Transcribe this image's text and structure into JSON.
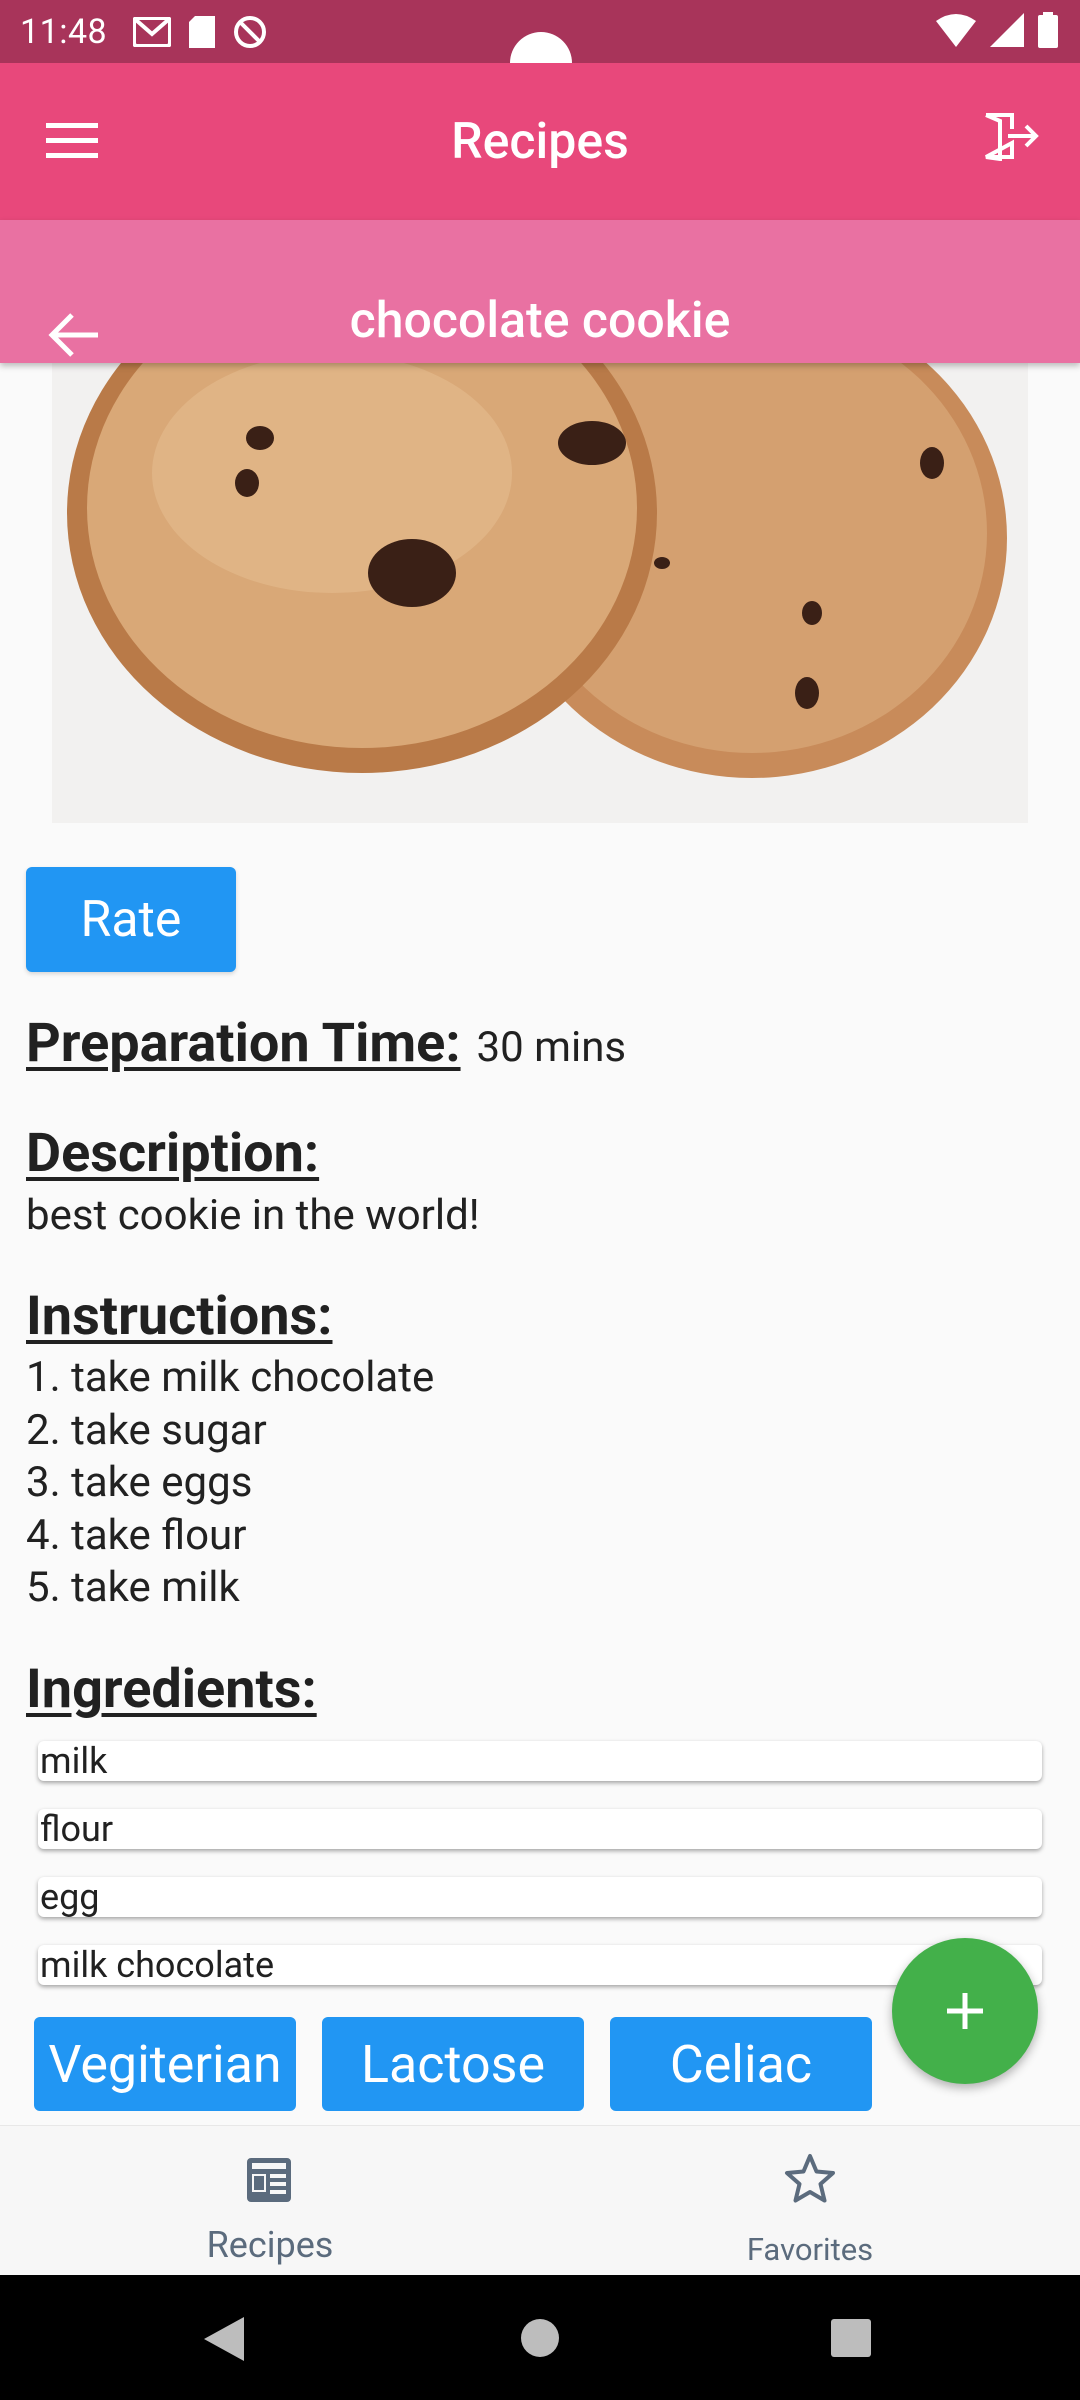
{
  "status_bar": {
    "time": "11:48"
  },
  "app_bar": {
    "title": "Recipes",
    "menu_icon": "menu-icon",
    "logout_icon": "logout-icon"
  },
  "detail_bar": {
    "title": "chocolate cookie",
    "back_icon": "arrow-back-icon"
  },
  "recipe": {
    "rate_label": "Rate",
    "prep_heading": "Preparation Time:",
    "prep_value": "30 mins",
    "desc_heading": "Description:",
    "description": "best cookie in the world!",
    "instr_heading": "Instructions:",
    "instructions": [
      "1. take milk chocolate",
      "2. take sugar",
      "3. take eggs",
      "4. take flour",
      "5. take milk"
    ],
    "ingr_heading": "Ingredients:",
    "ingredients": [
      "milk",
      "flour",
      "egg",
      "milk chocolate"
    ],
    "tags": [
      "Vegiterian",
      "Lactose",
      "Celiac"
    ]
  },
  "fab": {
    "icon": "plus-icon"
  },
  "bottom_nav": {
    "items": [
      {
        "label": "Recipes",
        "icon": "recipes-icon"
      },
      {
        "label": "Favorites",
        "icon": "star-icon"
      }
    ]
  },
  "colors": {
    "status_bar": "#a8345a",
    "app_bar": "#e8487b",
    "detail_bar": "#e971a2",
    "button": "#2196f3",
    "fab": "#43b04a"
  }
}
